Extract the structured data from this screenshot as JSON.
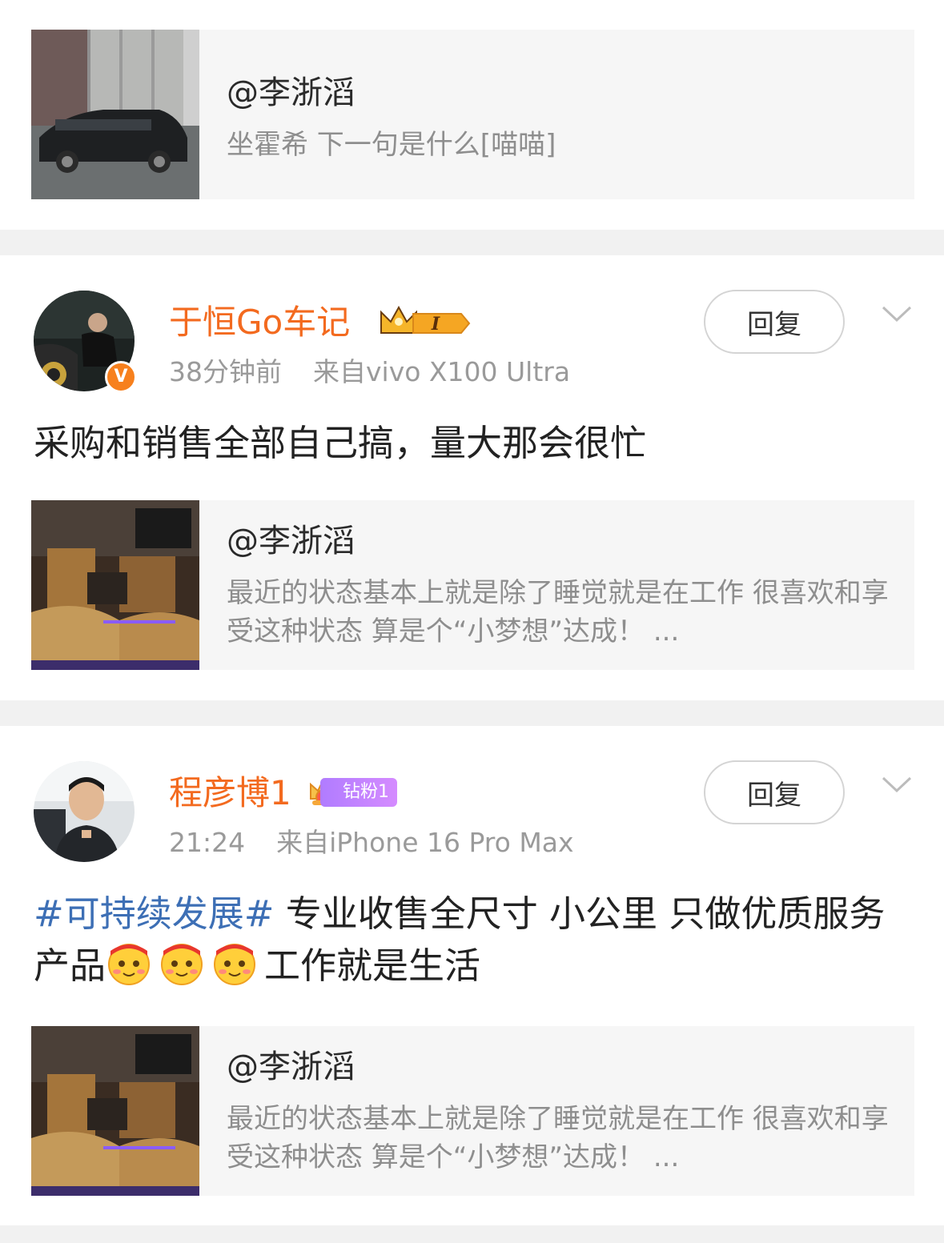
{
  "top_quote": {
    "user": "@李浙滔",
    "text": "坐霍希 下一句是什么[喵喵]"
  },
  "posts": [
    {
      "username": "于恒Go车记",
      "verified_badge": "V",
      "badge_level": "I",
      "time": "38分钟前",
      "source": "来自vivo X100 Ultra",
      "reply_label": "回复",
      "text": "采购和销售全部自己搞，量大那会很忙",
      "quote": {
        "user": "@李浙滔",
        "text": "最近的状态基本上就是除了睡觉就是在工作 很喜欢和享受这种状态 算是个“小梦想”达成！ ..."
      }
    },
    {
      "username": "程彦博1",
      "fans_badge": "钻粉1",
      "time": "21:24",
      "source": "来自iPhone 16 Pro Max",
      "reply_label": "回复",
      "hashtag": "#可持续发展#",
      "text_part1": " 专业收售全尺寸 小公里 只做优质服务产品",
      "text_part2": "工作就是生活",
      "emoji_count": 3,
      "quote": {
        "user": "@李浙滔",
        "text": "最近的状态基本上就是除了睡觉就是在工作 很喜欢和享受这种状态 算是个“小梦想”达成！ ..."
      }
    }
  ],
  "colors": {
    "username": "#f36a1f",
    "hashtag": "#3d6fb5",
    "separator": "#f1f1f1",
    "quote_bg": "#f6f6f6"
  }
}
